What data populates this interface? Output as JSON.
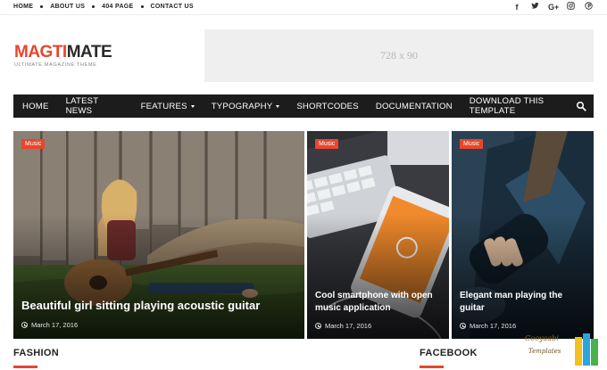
{
  "top_nav": {
    "items": [
      "HOME",
      "ABOUT US",
      "404 PAGE",
      "CONTACT US"
    ]
  },
  "socials": [
    {
      "icon": "facebook-icon",
      "glyph": "f"
    },
    {
      "icon": "twitter-icon",
      "glyph": "🐦"
    },
    {
      "icon": "google-plus-icon",
      "glyph": "G+"
    },
    {
      "icon": "instagram-icon",
      "glyph": "◎"
    },
    {
      "icon": "pinterest-icon",
      "glyph": "℗"
    }
  ],
  "logo": {
    "part1": "MAGTI",
    "part2": "MATE",
    "tagline": "ULTIMATE MAGAZINE THEME"
  },
  "ad": {
    "label": "728 x 90"
  },
  "main_nav": {
    "items": [
      "HOME",
      "LATEST NEWS",
      "FEATURES",
      "TYPOGRAPHY",
      "SHORTCODES",
      "DOCUMENTATION",
      "DOWNLOAD THIS TEMPLATE"
    ]
  },
  "featured": [
    {
      "category": "Music",
      "title": "Beautiful girl sitting playing acoustic guitar",
      "date": "March 17, 2016"
    },
    {
      "category": "Music",
      "title": "Cool smartphone with open music application",
      "date": "March 17, 2016"
    },
    {
      "category": "Music",
      "title": "Elegant man playing the guitar",
      "date": "March 17, 2016"
    }
  ],
  "sections": {
    "left": "FASHION",
    "right": "FACEBOOK"
  },
  "watermark": {
    "line1": "Gooyaabi",
    "line2": "Templates"
  },
  "colors": {
    "accent": "#e8452d",
    "nav_bg": "#1c1c1c"
  }
}
